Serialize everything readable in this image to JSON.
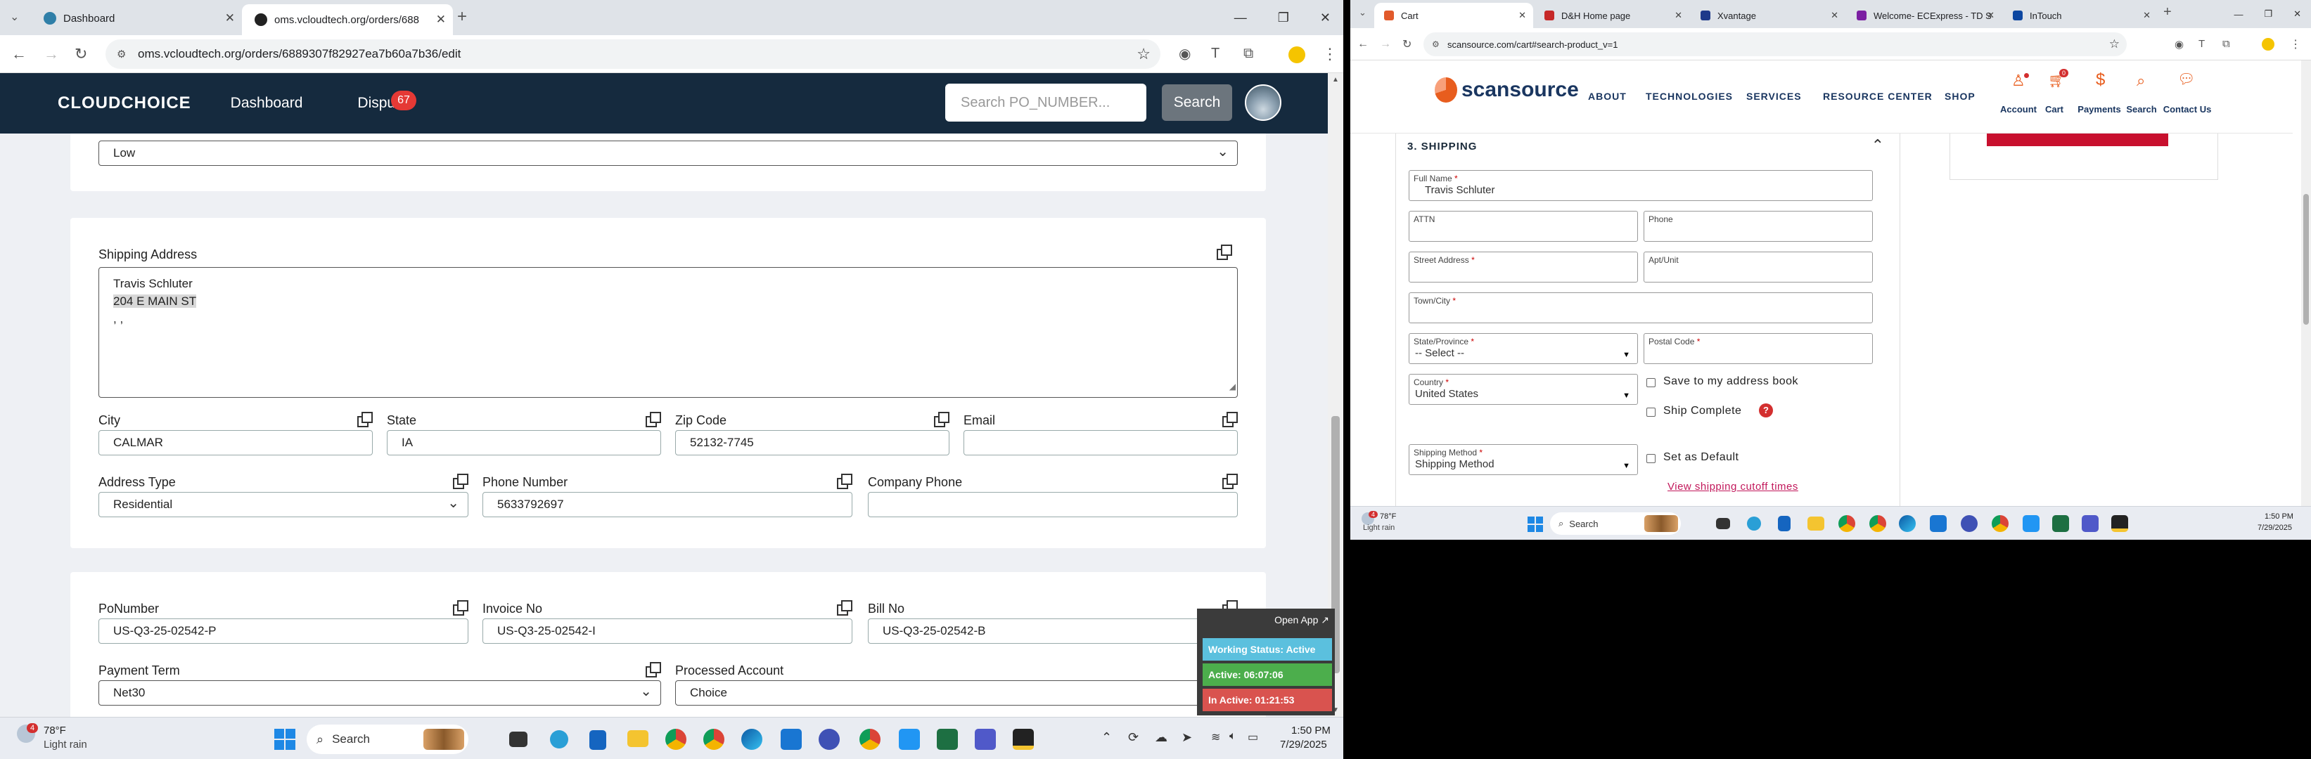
{
  "left_window": {
    "tabs": [
      {
        "label": "Dashboard"
      },
      {
        "label": "oms.vcloudtech.org/orders/688"
      }
    ],
    "url": "oms.vcloudtech.org/orders/6889307f82927ea7b60a7b36/edit",
    "navbar": {
      "logo": "CLOUDCHOICE",
      "links": [
        "Dashboard",
        "Dispu"
      ],
      "badge": "67",
      "search_placeholder": "Search PO_NUMBER...",
      "search_button": "Search"
    },
    "priority_value": "Low",
    "shipping": {
      "label": "Shipping Address",
      "address_line1": "Travis Schluter",
      "address_line2": "204 E MAIN ST",
      "address_line3": ", ,",
      "city_label": "City",
      "city": "CALMAR",
      "state_label": "State",
      "state": "IA",
      "zip_label": "Zip Code",
      "zip": "52132-7745",
      "email_label": "Email",
      "email": "",
      "address_type_label": "Address Type",
      "address_type": "Residential",
      "phone_label": "Phone Number",
      "phone": "5633792697",
      "company_phone_label": "Company Phone",
      "company_phone": ""
    },
    "order": {
      "po_label": "PoNumber",
      "po": "US-Q3-25-02542-P",
      "invoice_label": "Invoice No",
      "invoice": "US-Q3-25-02542-I",
      "bill_label": "Bill No",
      "bill": "US-Q3-25-02542-B",
      "payment_label": "Payment Term",
      "payment": "Net30",
      "account_label": "Processed Account",
      "account": "Choice"
    },
    "widget": {
      "open_app": "Open App ↗",
      "working": "Working Status: Active",
      "active": "Active: 06:07:06",
      "inactive": "In Active: 01:21:53"
    },
    "taskbar": {
      "weather_temp": "78°F",
      "weather_desc": "Light rain",
      "weather_badge": "4",
      "search": "Search",
      "time": "1:50 PM",
      "date": "7/29/2025"
    }
  },
  "right_window": {
    "tabs": [
      {
        "label": "Cart"
      },
      {
        "label": "D&H Home page"
      },
      {
        "label": "Xvantage"
      },
      {
        "label": "Welcome- ECExpress - TD S"
      },
      {
        "label": "InTouch"
      }
    ],
    "url": "scansource.com/cart#search-product_v=1",
    "site": {
      "logo": "scansource",
      "menu": [
        "ABOUT",
        "TECHNOLOGIES",
        "SERVICES",
        "RESOURCE CENTER",
        "SHOP"
      ],
      "utility": [
        "Account",
        "Cart",
        "Payments",
        "Search",
        "Contact Us"
      ],
      "cart_count": "0"
    },
    "section_title": "3. SHIPPING",
    "form": {
      "full_name_label": "Full Name",
      "full_name": "Travis Schluter",
      "attn_label": "ATTN",
      "phone_label": "Phone",
      "street_label": "Street Address",
      "apt_label": "Apt/Unit",
      "town_label": "Town/City",
      "state_label": "State/Province",
      "state_value": "-- Select --",
      "postal_label": "Postal Code",
      "country_label": "Country",
      "country_value": "United States",
      "save_address": "Save to my address book",
      "ship_complete": "Ship Complete",
      "ship_method_label": "Shipping Method",
      "ship_method_value": "Shipping Method",
      "set_default": "Set as Default",
      "cutoff_link": "View shipping cutoff times"
    },
    "taskbar": {
      "weather_temp": "78°F",
      "weather_desc": "Light rain",
      "weather_badge": "4",
      "search": "Search",
      "time": "1:50 PM",
      "date": "7/29/2025"
    }
  }
}
